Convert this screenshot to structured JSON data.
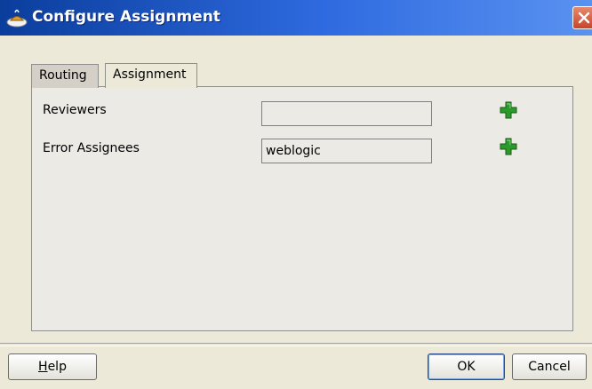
{
  "window": {
    "title": "Configure Assignment",
    "app_icon": "oracle-jdeveloper-icon",
    "close_icon": "close-icon"
  },
  "tabs": [
    {
      "label": "Routing",
      "active": false
    },
    {
      "label": "Assignment",
      "active": true
    }
  ],
  "form": {
    "reviewers": {
      "label": "Reviewers",
      "value": "",
      "add_icon": "plus-icon"
    },
    "error_assignees": {
      "label": "Error Assignees",
      "value": "weblogic",
      "add_icon": "plus-icon"
    }
  },
  "buttons": {
    "help_prefix": "",
    "help_mnemonic": "H",
    "help_rest": "elp",
    "ok": "OK",
    "cancel": "Cancel"
  },
  "colors": {
    "title_bar": "#2f6be0",
    "plus_icon": "#2a9a2a"
  }
}
